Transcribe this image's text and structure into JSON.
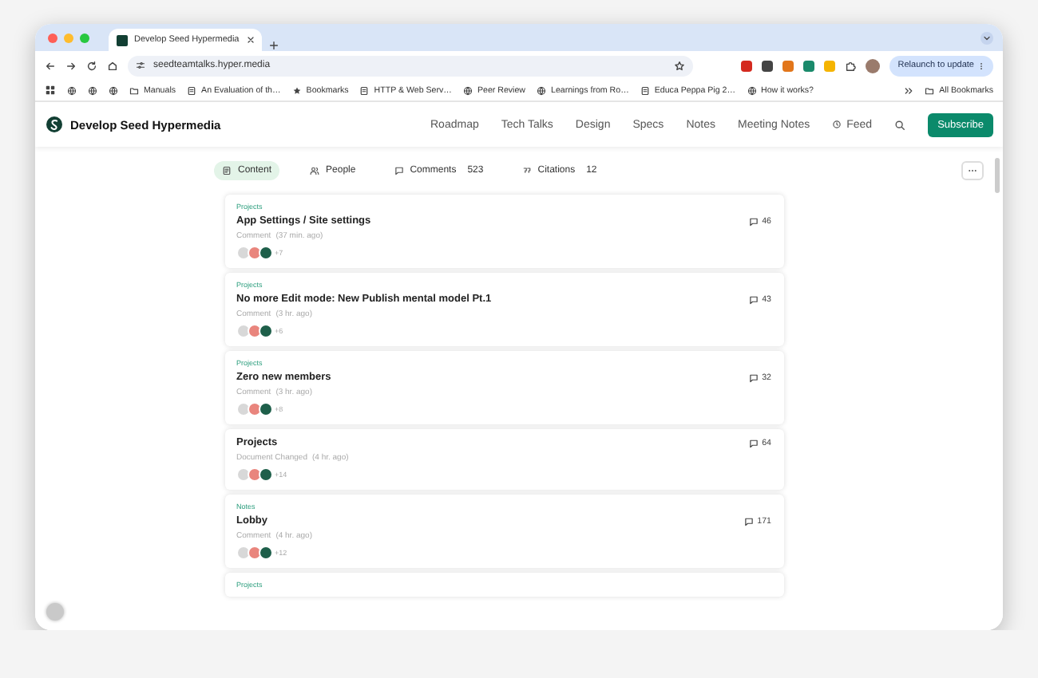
{
  "browser": {
    "tab_title": "Develop Seed Hypermedia",
    "url": "seedteamtalks.hyper.media",
    "update_button": "Relaunch to update",
    "bookmarks": [
      {
        "kind": "folder",
        "label": "Manuals"
      },
      {
        "kind": "page",
        "label": "An Evaluation of th…"
      },
      {
        "kind": "star",
        "label": "Bookmarks"
      },
      {
        "kind": "page",
        "label": "HTTP & Web Serv…"
      },
      {
        "kind": "globe",
        "label": "Peer Review"
      },
      {
        "kind": "globe",
        "label": "Learnings from Ro…"
      },
      {
        "kind": "page",
        "label": "Educa Peppa Pig 2…"
      },
      {
        "kind": "globe",
        "label": "How it works?"
      }
    ],
    "all_bookmarks": "All Bookmarks"
  },
  "site": {
    "title": "Develop Seed Hypermedia",
    "nav": [
      "Roadmap",
      "Tech Talks",
      "Design",
      "Specs",
      "Notes",
      "Meeting Notes"
    ],
    "feed": "Feed",
    "subscribe": "Subscribe"
  },
  "tabs": [
    {
      "kind": "content",
      "label": "Content",
      "selected": true
    },
    {
      "kind": "people",
      "label": "People",
      "selected": false
    },
    {
      "kind": "comments",
      "label": "Comments",
      "count": "523",
      "selected": false
    },
    {
      "kind": "citations",
      "label": "Citations",
      "count": "12",
      "selected": false
    }
  ],
  "cards": [
    {
      "category": "Projects",
      "title": "App Settings / Site settings",
      "event": "Comment",
      "time": "(37 min. ago)",
      "more": "+7",
      "comments": "46"
    },
    {
      "category": "Projects",
      "title": "No more Edit mode: New Publish mental model Pt.1",
      "event": "Comment",
      "time": "(3 hr. ago)",
      "more": "+6",
      "comments": "43"
    },
    {
      "category": "Projects",
      "title": "Zero new members",
      "event": "Comment",
      "time": "(3 hr. ago)",
      "more": "+8",
      "comments": "32"
    },
    {
      "title": "Projects",
      "event": "Document Changed",
      "time": "(4 hr. ago)",
      "more": "+14",
      "comments": "64"
    },
    {
      "category": "Notes",
      "title": "Lobby",
      "event": "Comment",
      "time": "(4 hr. ago)",
      "more": "+12",
      "comments": "171"
    },
    {
      "category": "Projects"
    }
  ]
}
